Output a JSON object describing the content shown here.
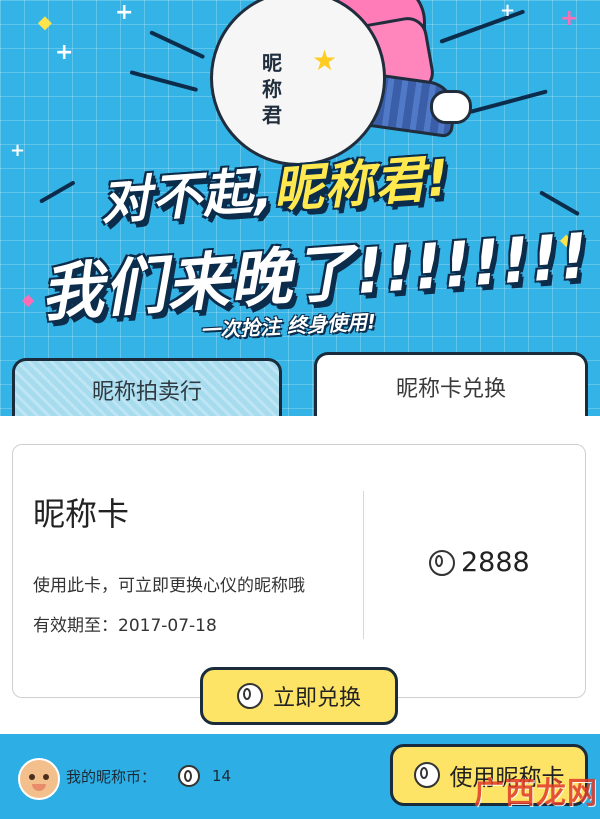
{
  "banner": {
    "mascot_label": "昵称君",
    "headline_prefix": "对不起,",
    "headline_highlight": "昵称君!",
    "headline_line2": "我们来晚了!!!!!!!!",
    "slogan": "一次抢注 终身使用!"
  },
  "tabs": [
    {
      "label": "昵称拍卖行",
      "active": false
    },
    {
      "label": "昵称卡兑换",
      "active": true
    }
  ],
  "card": {
    "title": "昵称卡",
    "description": "使用此卡，可立即更换心仪的昵称哦",
    "validity": "有效期至：2017-07-18",
    "price": "2888",
    "price_icon": "coin-icon"
  },
  "redeem_button": {
    "label": "立即兑换",
    "icon": "coin-icon"
  },
  "footer": {
    "coins_label": "我的昵称币：",
    "coins_count": "14",
    "use_button_label": "使用昵称卡",
    "avatar": "avatar-icon"
  },
  "watermark": "广西龙网",
  "colors": {
    "background": "#34b3e6",
    "button_yellow": "#fde366",
    "headline_yellow": "#ffe94f",
    "outline": "#1a2b3b"
  }
}
